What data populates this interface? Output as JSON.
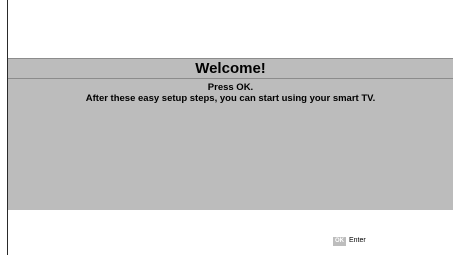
{
  "dialog": {
    "title": "Welcome!",
    "line1": "Press OK.",
    "line2": "After these easy setup steps, you can start using your smart TV."
  },
  "hint": {
    "key_label": "OK",
    "action_label": "Enter"
  },
  "colors": {
    "dialog_background": "#bcbcbc",
    "screen_background": "#ffffff",
    "ok_key_background": "#bdbdbd"
  }
}
